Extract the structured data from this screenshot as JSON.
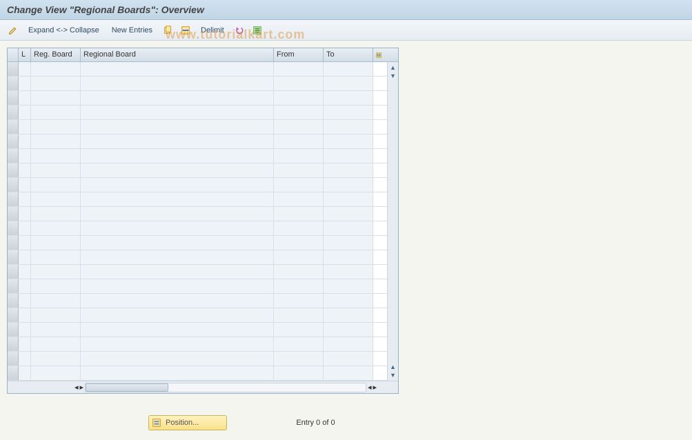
{
  "title": "Change View \"Regional Boards\": Overview",
  "toolbar": {
    "expand_collapse": "Expand <-> Collapse",
    "new_entries": "New Entries",
    "delimit": "Delimit"
  },
  "table": {
    "headers": {
      "l": "L",
      "reg_board": "Reg. Board",
      "regional_board": "Regional Board",
      "from": "From",
      "to": "To"
    },
    "row_count": 22
  },
  "footer": {
    "position_label": "Position...",
    "entry_text": "Entry 0 of 0"
  },
  "watermark": "www.tutorialkart.com"
}
